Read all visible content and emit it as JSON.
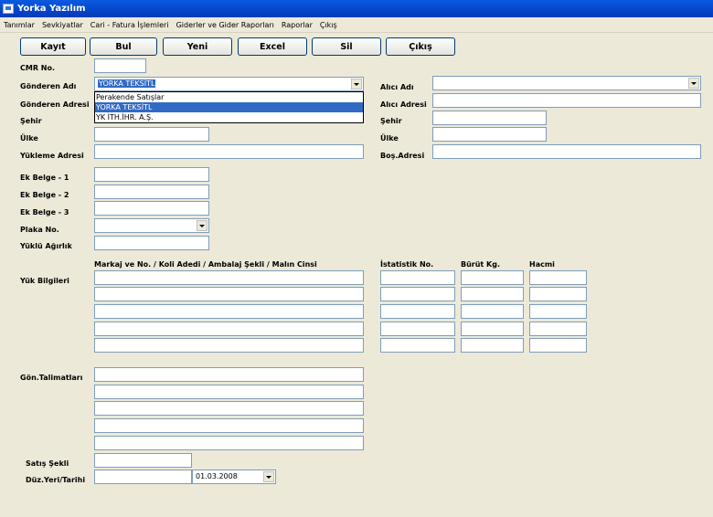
{
  "window": {
    "title": "Yorka Yazılım"
  },
  "menu": [
    "Tanımlar",
    "Sevkiyatlar",
    "Cari - Fatura İşlemleri",
    "Giderler ve Gider Raporları",
    "Raporlar",
    "Çıkış"
  ],
  "toolbar": {
    "save": "Kayıt",
    "find": "Bul",
    "new": "Yeni",
    "excel": "Excel",
    "delete": "Sil",
    "exit": "Çıkış"
  },
  "labels": {
    "cmr_no": "CMR No.",
    "sender_name": "Gönderen Adı",
    "sender_address": "Gönderen Adresi",
    "city": "Şehir",
    "country": "Ülke",
    "loading_address": "Yükleme Adresi",
    "receiver_name": "Alıcı Adı",
    "receiver_address": "Alıcı Adresi",
    "receiver_city": "Şehir",
    "receiver_country": "Ülke",
    "unloading_address": "Boş.Adresi",
    "ek_belge_1": "Ek Belge - 1",
    "ek_belge_2": "Ek Belge - 2",
    "ek_belge_3": "Ek Belge - 3",
    "plate_no": "Plaka No.",
    "load_weight": "Yüklü Ağırlık",
    "load_info": "Yük Bilgileri",
    "load_header": "Markaj ve No. / Koli Adedi / Ambalaj Şekli / Malın Cinsi",
    "stat_no": "İstatistik No.",
    "gross_kg": "Bürüt Kg.",
    "volume": "Hacmi",
    "instructions": "Gön.Talimatları",
    "sale_type": "Satış Şekli",
    "issue_place_date": "Düz.Yeri/Tarihi"
  },
  "fields": {
    "sender_name_value": "YORKA TEKSİTL",
    "issue_date": "01.03.2008"
  },
  "sender_dropdown": {
    "options": [
      "Perakende Satışlar",
      "YORKA TEKSİTL",
      "YK İTH.İHR. A.Ş."
    ],
    "selected_index": 1
  }
}
